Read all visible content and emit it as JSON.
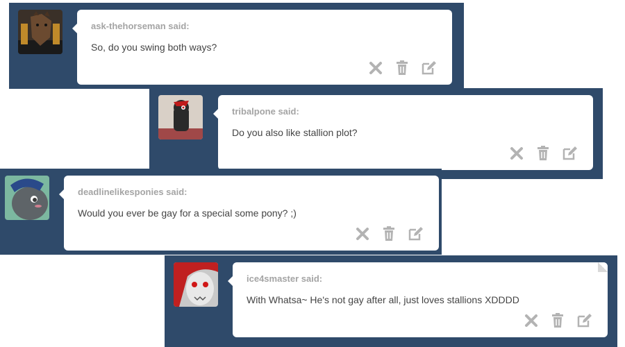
{
  "posts": [
    {
      "asker": "ask-thehorseman said:",
      "question": "So, do you swing both ways?",
      "avatar": "horse-head-avatar"
    },
    {
      "asker": "tribalpone said:",
      "question": "Do you also like stallion plot?",
      "avatar": "black-red-pony-avatar"
    },
    {
      "asker": "deadlinelikesponies said:",
      "question": "Would you ever be gay for a special some pony? ;)",
      "avatar": "grey-pony-avatar"
    },
    {
      "asker": "ice4smaster said:",
      "question": "With Whatsa~ He's not gay after all, just loves stallions XDDDD",
      "avatar": "red-mane-pony-avatar"
    }
  ],
  "icons": {
    "ignore": "close-icon",
    "delete": "trash-icon",
    "edit": "edit-icon"
  },
  "colors": {
    "panel": "#2f4a6a",
    "asker_text": "#a4a4a4",
    "icon": "#b3b3b3"
  }
}
